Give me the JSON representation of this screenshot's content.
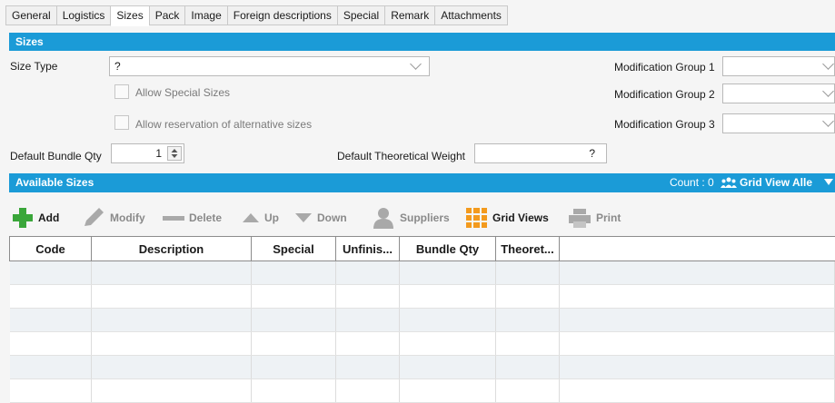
{
  "tabs": [
    "General",
    "Logistics",
    "Sizes",
    "Pack",
    "Image",
    "Foreign descriptions",
    "Special",
    "Remark",
    "Attachments"
  ],
  "active_tab": "Sizes",
  "sizes_section": {
    "title": "Sizes",
    "size_type_label": "Size Type",
    "size_type_value": "?",
    "allow_special_sizes": "Allow Special Sizes",
    "allow_reservation": "Allow reservation of alternative sizes",
    "mod_group_1": "Modification Group 1",
    "mod_group_2": "Modification Group 2",
    "mod_group_3": "Modification Group 3",
    "default_bundle_qty_label": "Default Bundle Qty",
    "default_bundle_qty_value": "1",
    "default_weight_label": "Default Theoretical Weight",
    "default_weight_value": "?"
  },
  "available_sizes": {
    "title": "Available Sizes",
    "count_label": "Count : 0",
    "grid_view_label": "Grid View Alle"
  },
  "toolbar": {
    "add": "Add",
    "modify": "Modify",
    "delete": "Delete",
    "up": "Up",
    "down": "Down",
    "suppliers": "Suppliers",
    "grid_views": "Grid Views",
    "print": "Print"
  },
  "columns": [
    "Code",
    "Description",
    "Special",
    "Unfinis...",
    "Bundle Qty",
    "Theoret..."
  ],
  "colors": {
    "accent": "#1b9bd7",
    "add_green": "#3aa63a",
    "grid_orange": "#f39a1d"
  },
  "icons": [
    "plus-icon",
    "pencil-icon",
    "minus-icon",
    "arrow-up-icon",
    "arrow-down-icon",
    "user-icon",
    "grid-icon",
    "printer-icon",
    "users-icon",
    "dropdown-triangle-icon"
  ]
}
